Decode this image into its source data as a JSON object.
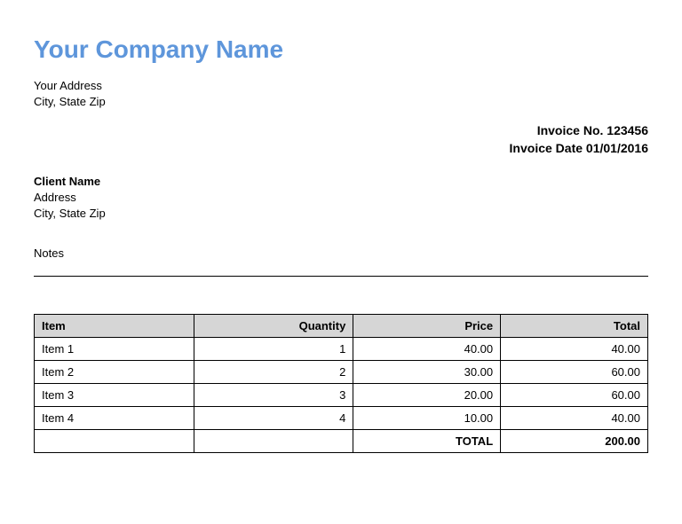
{
  "company": {
    "name": "Your Company Name",
    "address_line1": "Your Address",
    "address_line2": "City, State Zip"
  },
  "invoice": {
    "number_label": "Invoice No.",
    "number": "123456",
    "date_label": "Invoice Date",
    "date": "01/01/2016"
  },
  "client": {
    "name": "Client Name",
    "address_line1": "Address",
    "address_line2": "City, State Zip"
  },
  "notes_label": "Notes",
  "table": {
    "headers": {
      "item": "Item",
      "quantity": "Quantity",
      "price": "Price",
      "total": "Total"
    },
    "rows": [
      {
        "item": "Item 1",
        "quantity": "1",
        "price": "40.00",
        "total": "40.00"
      },
      {
        "item": "Item 2",
        "quantity": "2",
        "price": "30.00",
        "total": "60.00"
      },
      {
        "item": "Item 3",
        "quantity": "3",
        "price": "20.00",
        "total": "60.00"
      },
      {
        "item": "Item 4",
        "quantity": "4",
        "price": "10.00",
        "total": "40.00"
      }
    ],
    "footer": {
      "label": "TOTAL",
      "value": "200.00"
    }
  }
}
